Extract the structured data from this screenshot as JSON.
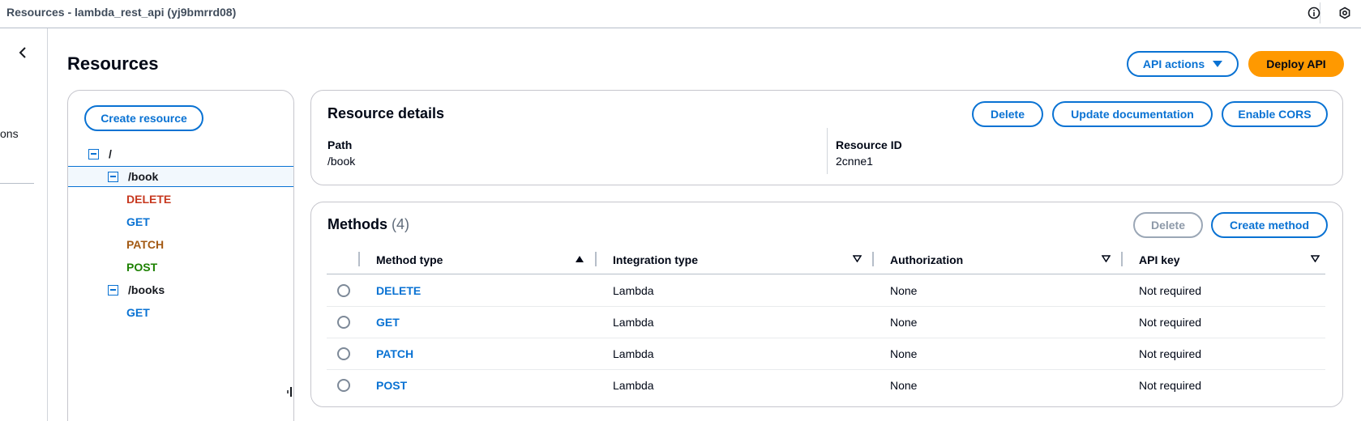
{
  "window": {
    "title": "Resources - lambda_rest_api (yj9bmrrd08)"
  },
  "topbar_icons": [
    "info-icon",
    "settings-icon"
  ],
  "leftnav": {
    "partial_text": "ons"
  },
  "page": {
    "title": "Resources",
    "api_actions_label": "API actions",
    "deploy_label": "Deploy API"
  },
  "tree": {
    "create_resource_label": "Create resource",
    "root": "/",
    "book": "/book",
    "book_methods": [
      "DELETE",
      "GET",
      "PATCH",
      "POST"
    ],
    "books": "/books",
    "books_methods": [
      "GET"
    ]
  },
  "resource_details": {
    "title": "Resource details",
    "delete_label": "Delete",
    "update_doc_label": "Update documentation",
    "enable_cors_label": "Enable CORS",
    "path_label": "Path",
    "path_value": "/book",
    "resource_id_label": "Resource ID",
    "resource_id_value": "2cnne1"
  },
  "methods": {
    "title": "Methods",
    "count": "(4)",
    "delete_label": "Delete",
    "create_label": "Create method",
    "columns": [
      "Method type",
      "Integration type",
      "Authorization",
      "API key"
    ],
    "rows": [
      {
        "method": "DELETE",
        "integration": "Lambda",
        "authorization": "None",
        "api_key": "Not required"
      },
      {
        "method": "GET",
        "integration": "Lambda",
        "authorization": "None",
        "api_key": "Not required"
      },
      {
        "method": "PATCH",
        "integration": "Lambda",
        "authorization": "None",
        "api_key": "Not required"
      },
      {
        "method": "POST",
        "integration": "Lambda",
        "authorization": "None",
        "api_key": "Not required"
      }
    ]
  }
}
